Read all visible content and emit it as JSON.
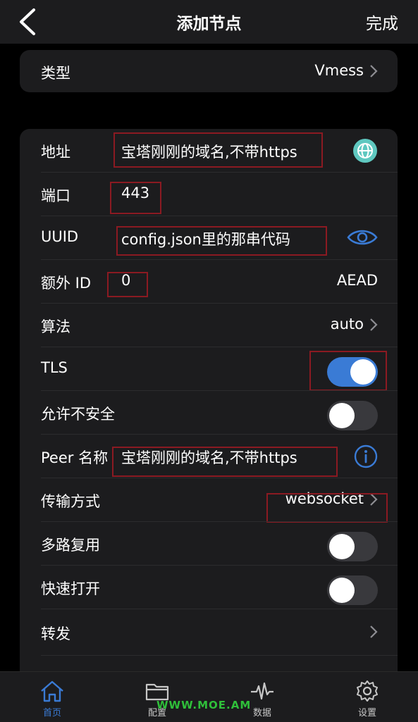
{
  "nav": {
    "title": "添加节点",
    "done": "完成"
  },
  "type_row": {
    "label": "类型",
    "value": "Vmess"
  },
  "rows": {
    "address": {
      "label": "地址",
      "value": "宝塔刚刚的域名,不带https"
    },
    "port": {
      "label": "端口",
      "value": "443"
    },
    "uuid": {
      "label": "UUID",
      "value": "config.json里的那串代码"
    },
    "alter_id": {
      "label": "额外 ID",
      "value": "0",
      "right": "AEAD"
    },
    "algorithm": {
      "label": "算法",
      "value": "auto"
    },
    "tls": {
      "label": "TLS",
      "on": true
    },
    "insecure": {
      "label": "允许不安全",
      "on": false
    },
    "peer": {
      "label": "Peer 名称",
      "value": "宝塔刚刚的域名,不带https"
    },
    "transport": {
      "label": "传输方式",
      "value": "websocket"
    },
    "mux": {
      "label": "多路复用",
      "on": false
    },
    "fast_open": {
      "label": "快速打开",
      "on": false
    },
    "forward": {
      "label": "转发"
    }
  },
  "tabbar": [
    {
      "label": "首页",
      "icon": "home-icon",
      "active": true
    },
    {
      "label": "配置",
      "icon": "folder-icon",
      "active": false
    },
    {
      "label": "数据",
      "icon": "pulse-icon",
      "active": false
    },
    {
      "label": "设置",
      "icon": "gear-icon",
      "active": false
    }
  ],
  "watermark": "WWW.MOE.AM",
  "colors": {
    "accent": "#3a7bd5",
    "highlight_box": "#8b1a22",
    "teal_icon": "#5fc8c0",
    "background": "#000000",
    "card": "#1c1c1e"
  }
}
